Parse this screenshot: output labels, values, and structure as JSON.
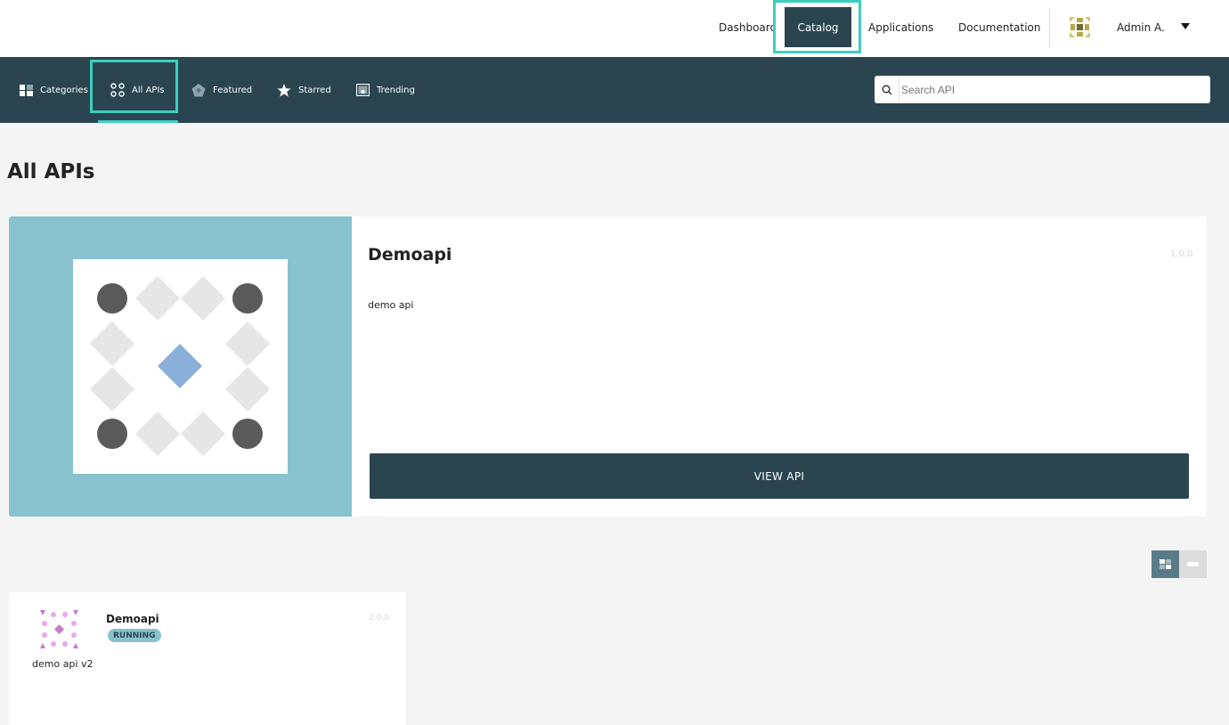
{
  "topnav": {
    "links": [
      "Dashboard",
      "Catalog",
      "Applications",
      "Documentation"
    ],
    "active": "Catalog",
    "user_name": "Admin A.",
    "avatar_icon": "generated-avatar-icon",
    "menu_icon": "caret-down-icon"
  },
  "subnav": {
    "items": [
      {
        "label": "Categories",
        "icon": "categories-icon"
      },
      {
        "label": "All APIs",
        "icon": "all-apis-icon"
      },
      {
        "label": "Featured",
        "icon": "featured-icon"
      },
      {
        "label": "Starred",
        "icon": "star-icon"
      },
      {
        "label": "Trending",
        "icon": "trending-icon"
      }
    ],
    "active": "All APIs",
    "search_placeholder": "Search API"
  },
  "page": {
    "title": "All APIs"
  },
  "featured": {
    "name": "Demoapi",
    "version": "1.0.0",
    "description": "demo api",
    "button_label": "VIEW API"
  },
  "view_toggle": {
    "options": [
      "grid",
      "list"
    ],
    "selected": "grid"
  },
  "cards": [
    {
      "name": "Demoapi",
      "version": "2.0.0",
      "status": "RUNNING",
      "description": "demo api v2"
    }
  ],
  "colors": {
    "primary": "#2a4550",
    "accent": "#3ccfbf",
    "thumb_bg": "#88c2cf",
    "background": "#f4f4f4"
  }
}
